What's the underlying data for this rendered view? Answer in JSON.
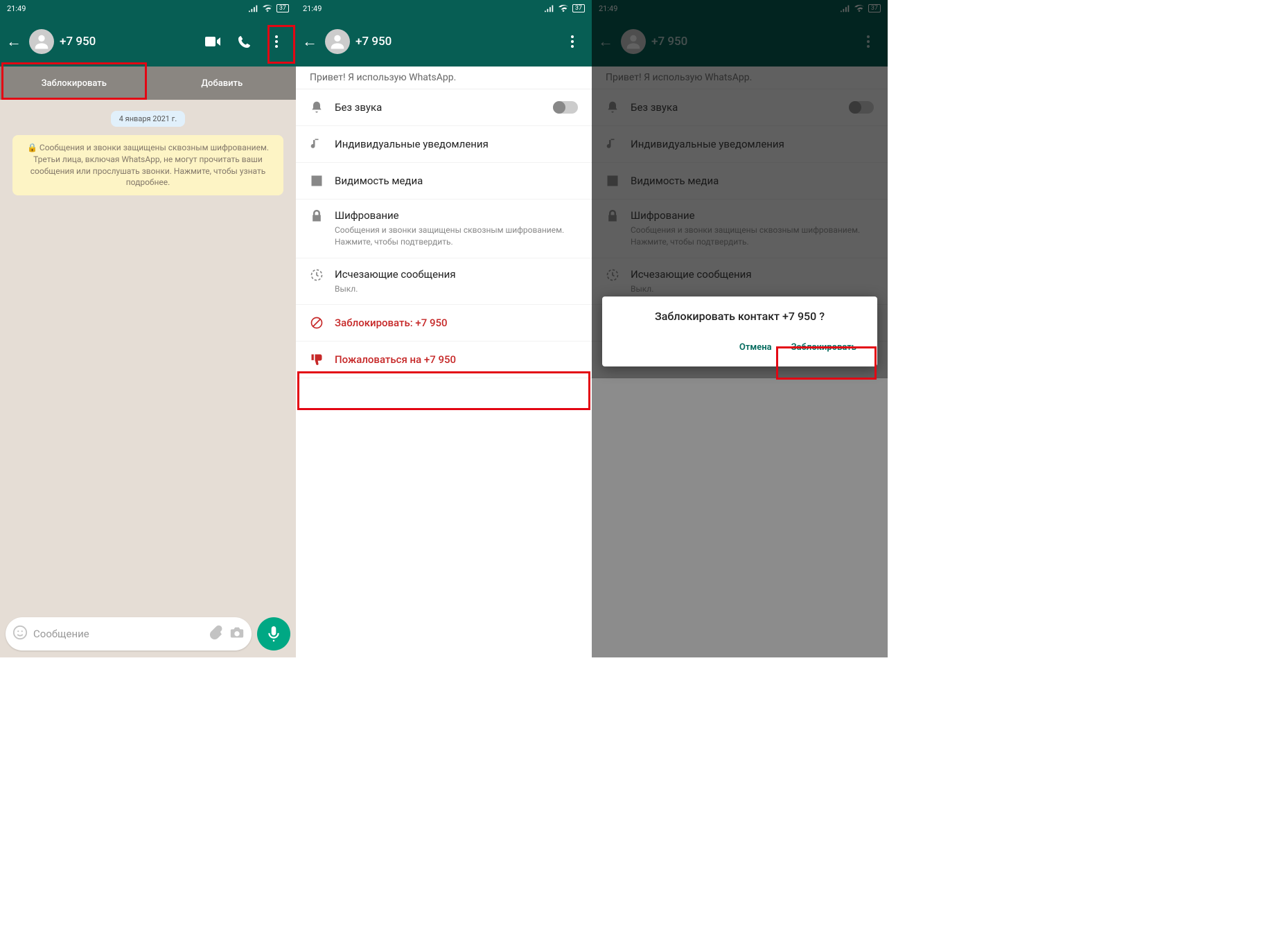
{
  "time": "21:49",
  "battery": "37",
  "contact_phone": "+7 950",
  "screen1": {
    "block_btn": "Заблокировать",
    "add_btn": "Добавить",
    "date": "4 января 2021 г.",
    "encrypt_text": "🔒 Сообщения и звонки защищены сквозным шифрованием. Третьи лица, включая WhatsApp, не могут прочитать ваши сообщения или прослушать звонки. Нажмите, чтобы узнать подробнее.",
    "input_placeholder": "Сообщение"
  },
  "settings": {
    "status_line": "Привет! Я использую WhatsApp.",
    "mute": "Без звука",
    "notifications": "Индивидуальные уведомления",
    "media": "Видимость медиа",
    "encryption_title": "Шифрование",
    "encryption_sub": "Сообщения и звонки защищены сквозным шифрованием. Нажмите, чтобы подтвердить.",
    "disappearing_title": "Исчезающие сообщения",
    "disappearing_sub": "Выкл.",
    "block": "Заблокировать: +7 950",
    "report": "Пожаловаться на +7 950"
  },
  "dialog": {
    "title": "Заблокировать контакт +7 950 ?",
    "cancel": "Отмена",
    "confirm": "Заблокировать"
  }
}
